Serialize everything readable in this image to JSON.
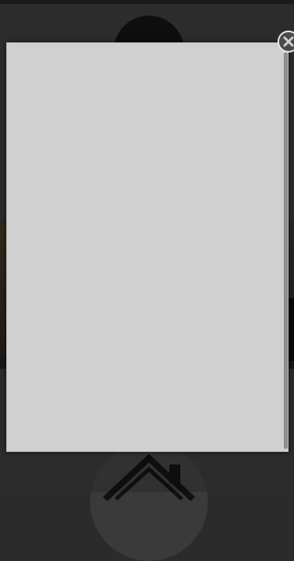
{
  "background": {
    "top_circle_icon": "avatar-circle",
    "home_icon": "home-icon"
  },
  "modal": {
    "content": "",
    "close_icon": "close-icon"
  },
  "colors": {
    "modal_bg": "#d0d0d0",
    "page_bg": "#2b2b2b",
    "close_bg": "#4a4a4a"
  }
}
